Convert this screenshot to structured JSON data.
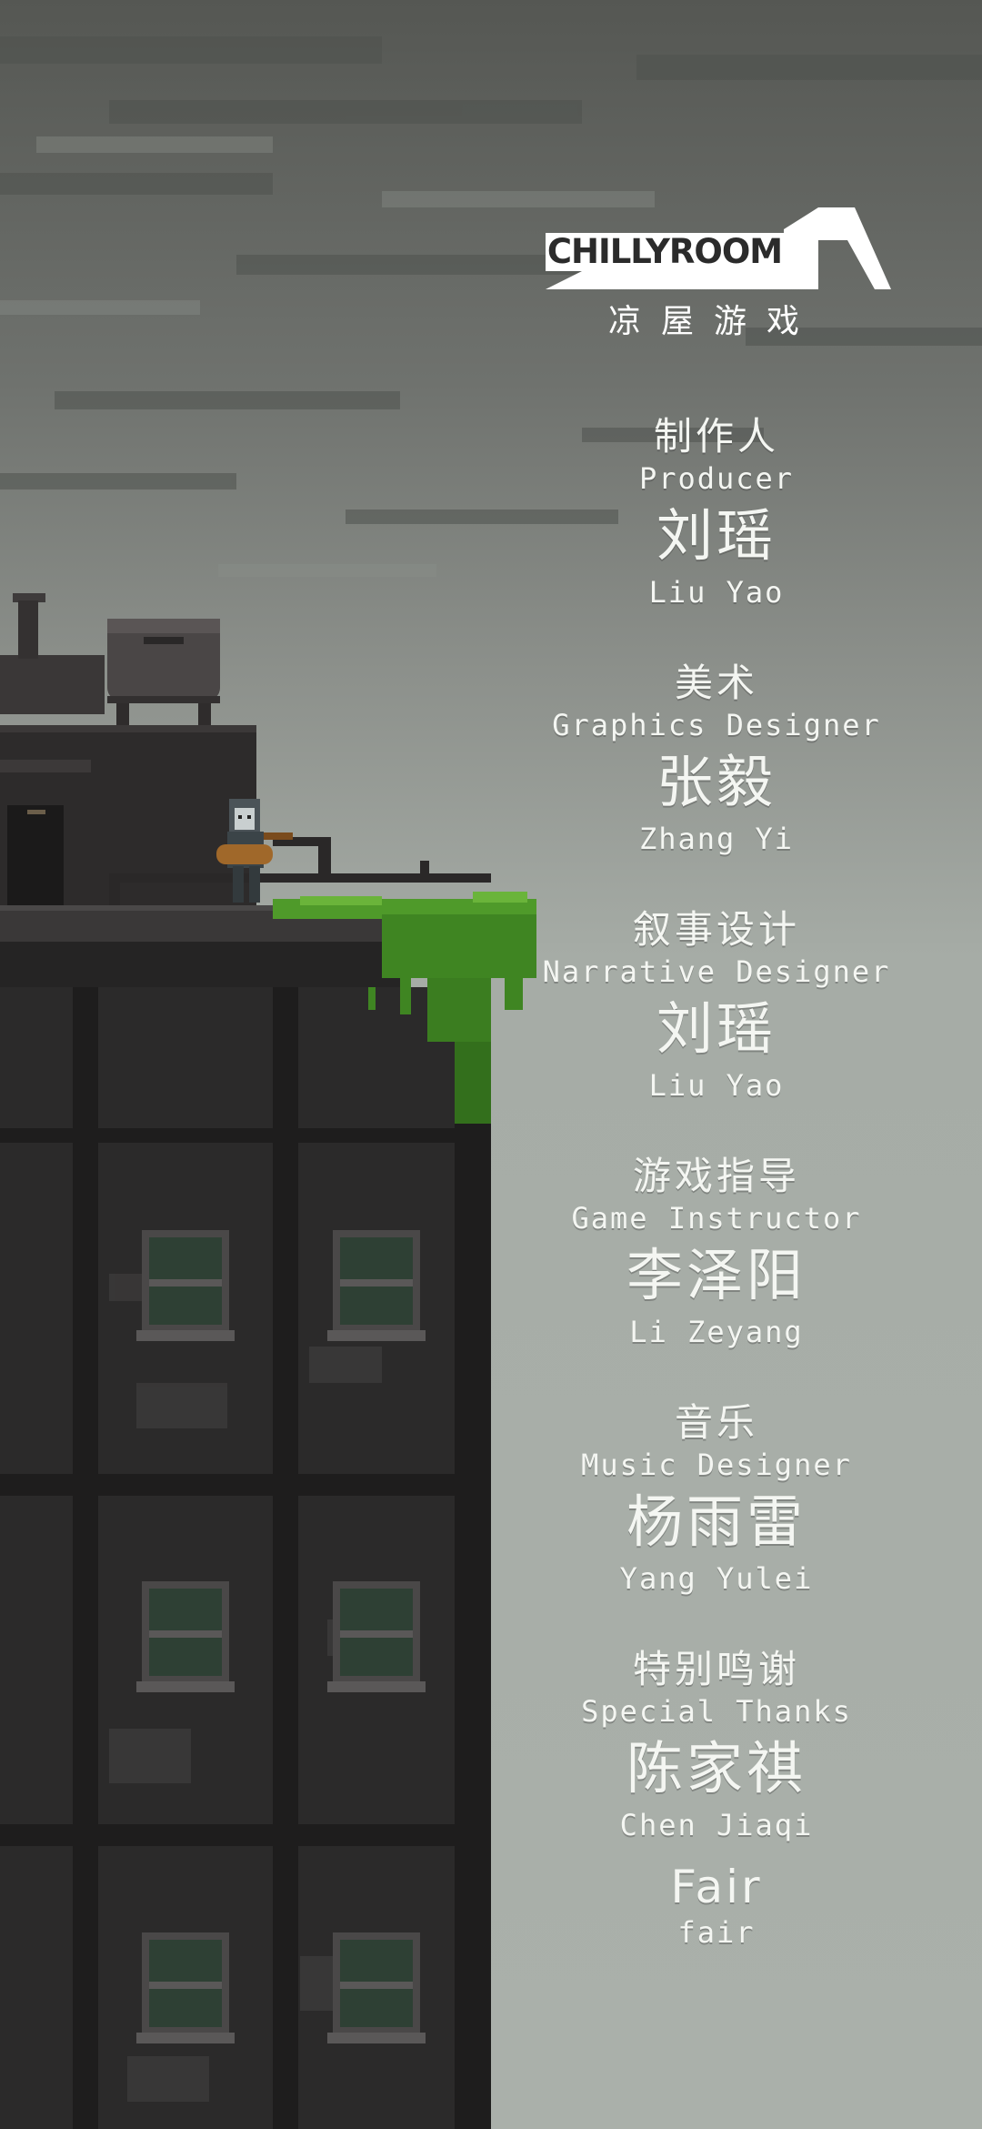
{
  "logo": {
    "wordmark": "CHILLYROOM",
    "glyph": "凉",
    "subtitle": "凉屋游戏"
  },
  "credits": [
    {
      "role_cn": "制作人",
      "role_en": "Producer",
      "name_cn": "刘瑶",
      "name_en": "Liu Yao"
    },
    {
      "role_cn": "美术",
      "role_en": "Graphics Designer",
      "name_cn": "张毅",
      "name_en": "Zhang Yi"
    },
    {
      "role_cn": "叙事设计",
      "role_en": "Narrative Designer",
      "name_cn": "刘瑶",
      "name_en": "Liu Yao"
    },
    {
      "role_cn": "游戏指导",
      "role_en": "Game Instructor",
      "name_cn": "李泽阳",
      "name_en": "Li Zeyang"
    },
    {
      "role_cn": "音乐",
      "role_en": "Music Designer",
      "name_cn": "杨雨雷",
      "name_en": "Yang Yulei"
    },
    {
      "role_cn": "特别鸣谢",
      "role_en": "Special Thanks",
      "name_cn": "陈家祺",
      "name_en": "Chen Jiaqi"
    }
  ],
  "extra_thanks": {
    "name": "Fair",
    "handle": "fair"
  },
  "colors": {
    "sky_dark": "#5d605b",
    "sky_light": "#a9afa9",
    "building": "#2c2c2c",
    "moss": "#4f9a2a",
    "text": "#f4f6f2"
  }
}
